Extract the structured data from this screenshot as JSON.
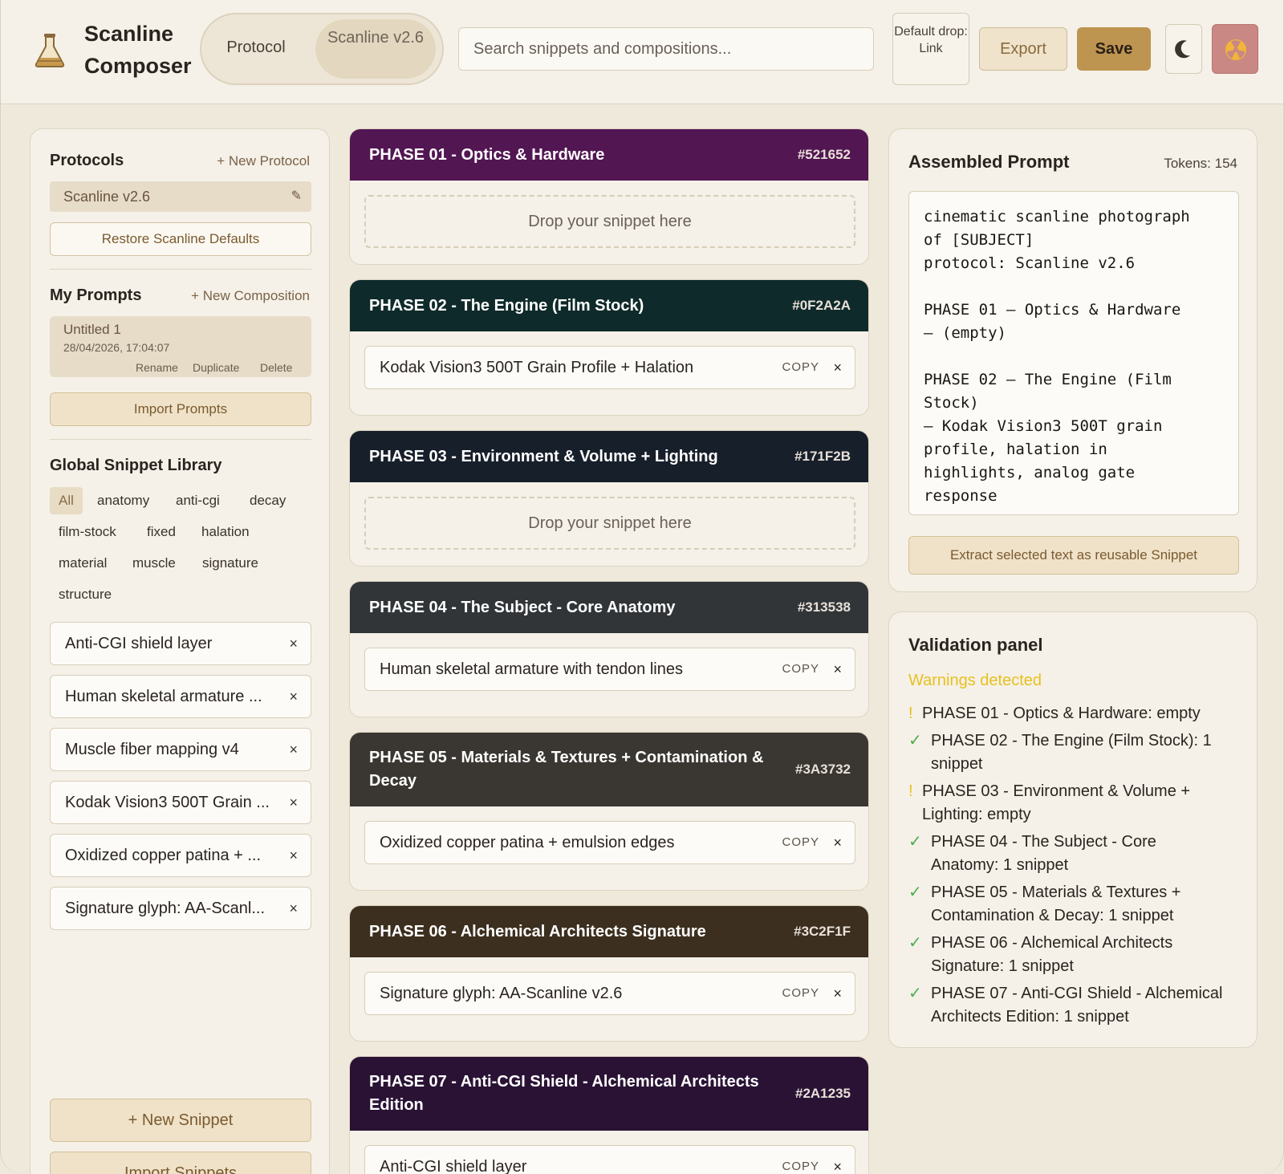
{
  "header": {
    "app_title": "Scanline Composer",
    "protocol_label": "Protocol",
    "protocol_value": "Scanline v2.6",
    "search_placeholder": "Search snippets and compositions...",
    "default_drop": "Default drop: Link",
    "export_label": "Export",
    "save_label": "Save"
  },
  "protocols": {
    "title": "Protocols",
    "new_link": "+ New Protocol",
    "items": [
      {
        "label": "Scanline v2.6"
      }
    ],
    "restore_label": "Restore Scanline Defaults"
  },
  "prompts": {
    "title": "My Prompts",
    "new_link": "+ New Composition",
    "items": [
      {
        "name": "Untitled 1",
        "date": "28/04/2026, 17:04:07",
        "rename": "Rename",
        "duplicate": "Duplicate",
        "delete": "Delete"
      }
    ],
    "import_label": "Import Prompts"
  },
  "library": {
    "title": "Global Snippet Library",
    "tags": [
      "All",
      "anatomy",
      "anti-cgi",
      "decay",
      "film-stock",
      "fixed",
      "halation",
      "material",
      "muscle",
      "signature",
      "structure"
    ],
    "snippets": [
      "Anti-CGI shield layer",
      "Human skeletal armature ...",
      "Muscle fiber mapping v4",
      "Kodak Vision3 500T Grain ...",
      "Oxidized copper patina + ...",
      "Signature glyph: AA-Scanl..."
    ],
    "new_snippet_label": "+ New Snippet",
    "import_snippets_label": "Import Snippets"
  },
  "phases": [
    {
      "title": "PHASE 01 - Optics & Hardware",
      "hex": "#521652",
      "color": "#521652",
      "snippet": null
    },
    {
      "title": "PHASE 02 - The Engine (Film Stock)",
      "hex": "#0F2A2A",
      "color": "#0F2A2A",
      "snippet": "Kodak Vision3 500T Grain Profile + Halation"
    },
    {
      "title": "PHASE 03 - Environment & Volume + Lighting",
      "hex": "#171F2B",
      "color": "#171F2B",
      "snippet": null
    },
    {
      "title": "PHASE 04 - The Subject - Core Anatomy",
      "hex": "#313538",
      "color": "#313538",
      "snippet": "Human skeletal armature with tendon lines"
    },
    {
      "title": "PHASE 05 - Materials & Textures + Contamination & Decay",
      "hex": "#3A3732",
      "color": "#3A3732",
      "snippet": "Oxidized copper patina + emulsion edges"
    },
    {
      "title": "PHASE 06 - Alchemical Architects Signature",
      "hex": "#3C2F1F",
      "color": "#3C2F1F",
      "snippet": "Signature glyph: AA-Scanline v2.6"
    },
    {
      "title": "PHASE 07 - Anti-CGI Shield - Alchemical Architects Edition",
      "hex": "#2A1235",
      "color": "#2A1235",
      "snippet": "Anti-CGI shield layer"
    }
  ],
  "phase_ui": {
    "drop_text": "Drop your snippet here",
    "copy_label": "COPY",
    "remove_glyph": "×"
  },
  "assembled": {
    "title": "Assembled Prompt",
    "tokens": "Tokens: 154",
    "text": "cinematic scanline photograph\nof [SUBJECT]\nprotocol: Scanline v2.6\n\nPHASE 01 — Optics & Hardware\n— (empty)\n\nPHASE 02 — The Engine (Film\nStock)\n— Kodak Vision3 500T grain\nprofile, halation in\nhighlights, analog gate\nresponse",
    "extract_label": "Extract selected text as reusable Snippet"
  },
  "validation": {
    "title": "Validation panel",
    "status": "Warnings detected",
    "items": [
      {
        "mark": "!",
        "kind": "warn",
        "text": "PHASE 01 - Optics & Hardware: empty"
      },
      {
        "mark": "✓",
        "kind": "ok",
        "text": "PHASE 02 - The Engine (Film Stock): 1 snippet"
      },
      {
        "mark": "!",
        "kind": "warn",
        "text": "PHASE 03 - Environment & Volume + Lighting: empty"
      },
      {
        "mark": "✓",
        "kind": "ok",
        "text": "PHASE 04 - The Subject - Core Anatomy: 1 snippet"
      },
      {
        "mark": "✓",
        "kind": "ok",
        "text": "PHASE 05 - Materials & Textures + Contamination & Decay: 1 snippet"
      },
      {
        "mark": "✓",
        "kind": "ok",
        "text": "PHASE 06 - Alchemical Architects Signature: 1 snippet"
      },
      {
        "mark": "✓",
        "kind": "ok",
        "text": "PHASE 07 - Anti-CGI Shield - Alchemical Architects Edition: 1 snippet"
      }
    ]
  }
}
